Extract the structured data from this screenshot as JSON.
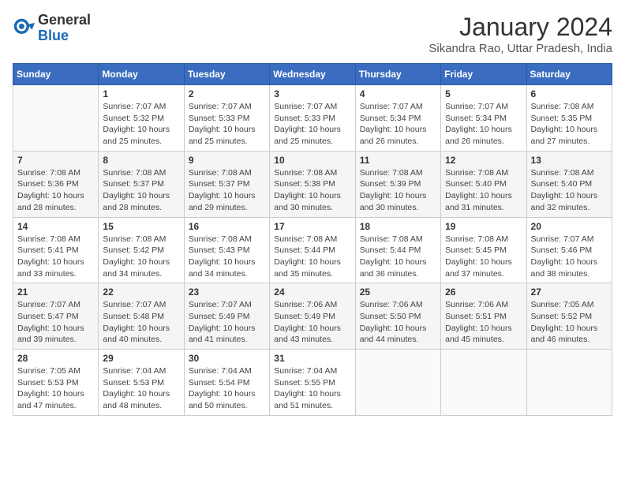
{
  "header": {
    "logo_general": "General",
    "logo_blue": "Blue",
    "month_year": "January 2024",
    "location": "Sikandra Rao, Uttar Pradesh, India"
  },
  "weekdays": [
    "Sunday",
    "Monday",
    "Tuesday",
    "Wednesday",
    "Thursday",
    "Friday",
    "Saturday"
  ],
  "weeks": [
    [
      {
        "day": "",
        "info": ""
      },
      {
        "day": "1",
        "info": "Sunrise: 7:07 AM\nSunset: 5:32 PM\nDaylight: 10 hours\nand 25 minutes."
      },
      {
        "day": "2",
        "info": "Sunrise: 7:07 AM\nSunset: 5:33 PM\nDaylight: 10 hours\nand 25 minutes."
      },
      {
        "day": "3",
        "info": "Sunrise: 7:07 AM\nSunset: 5:33 PM\nDaylight: 10 hours\nand 25 minutes."
      },
      {
        "day": "4",
        "info": "Sunrise: 7:07 AM\nSunset: 5:34 PM\nDaylight: 10 hours\nand 26 minutes."
      },
      {
        "day": "5",
        "info": "Sunrise: 7:07 AM\nSunset: 5:34 PM\nDaylight: 10 hours\nand 26 minutes."
      },
      {
        "day": "6",
        "info": "Sunrise: 7:08 AM\nSunset: 5:35 PM\nDaylight: 10 hours\nand 27 minutes."
      }
    ],
    [
      {
        "day": "7",
        "info": "Sunrise: 7:08 AM\nSunset: 5:36 PM\nDaylight: 10 hours\nand 28 minutes."
      },
      {
        "day": "8",
        "info": "Sunrise: 7:08 AM\nSunset: 5:37 PM\nDaylight: 10 hours\nand 28 minutes."
      },
      {
        "day": "9",
        "info": "Sunrise: 7:08 AM\nSunset: 5:37 PM\nDaylight: 10 hours\nand 29 minutes."
      },
      {
        "day": "10",
        "info": "Sunrise: 7:08 AM\nSunset: 5:38 PM\nDaylight: 10 hours\nand 30 minutes."
      },
      {
        "day": "11",
        "info": "Sunrise: 7:08 AM\nSunset: 5:39 PM\nDaylight: 10 hours\nand 30 minutes."
      },
      {
        "day": "12",
        "info": "Sunrise: 7:08 AM\nSunset: 5:40 PM\nDaylight: 10 hours\nand 31 minutes."
      },
      {
        "day": "13",
        "info": "Sunrise: 7:08 AM\nSunset: 5:40 PM\nDaylight: 10 hours\nand 32 minutes."
      }
    ],
    [
      {
        "day": "14",
        "info": "Sunrise: 7:08 AM\nSunset: 5:41 PM\nDaylight: 10 hours\nand 33 minutes."
      },
      {
        "day": "15",
        "info": "Sunrise: 7:08 AM\nSunset: 5:42 PM\nDaylight: 10 hours\nand 34 minutes."
      },
      {
        "day": "16",
        "info": "Sunrise: 7:08 AM\nSunset: 5:43 PM\nDaylight: 10 hours\nand 34 minutes."
      },
      {
        "day": "17",
        "info": "Sunrise: 7:08 AM\nSunset: 5:44 PM\nDaylight: 10 hours\nand 35 minutes."
      },
      {
        "day": "18",
        "info": "Sunrise: 7:08 AM\nSunset: 5:44 PM\nDaylight: 10 hours\nand 36 minutes."
      },
      {
        "day": "19",
        "info": "Sunrise: 7:08 AM\nSunset: 5:45 PM\nDaylight: 10 hours\nand 37 minutes."
      },
      {
        "day": "20",
        "info": "Sunrise: 7:07 AM\nSunset: 5:46 PM\nDaylight: 10 hours\nand 38 minutes."
      }
    ],
    [
      {
        "day": "21",
        "info": "Sunrise: 7:07 AM\nSunset: 5:47 PM\nDaylight: 10 hours\nand 39 minutes."
      },
      {
        "day": "22",
        "info": "Sunrise: 7:07 AM\nSunset: 5:48 PM\nDaylight: 10 hours\nand 40 minutes."
      },
      {
        "day": "23",
        "info": "Sunrise: 7:07 AM\nSunset: 5:49 PM\nDaylight: 10 hours\nand 41 minutes."
      },
      {
        "day": "24",
        "info": "Sunrise: 7:06 AM\nSunset: 5:49 PM\nDaylight: 10 hours\nand 43 minutes."
      },
      {
        "day": "25",
        "info": "Sunrise: 7:06 AM\nSunset: 5:50 PM\nDaylight: 10 hours\nand 44 minutes."
      },
      {
        "day": "26",
        "info": "Sunrise: 7:06 AM\nSunset: 5:51 PM\nDaylight: 10 hours\nand 45 minutes."
      },
      {
        "day": "27",
        "info": "Sunrise: 7:05 AM\nSunset: 5:52 PM\nDaylight: 10 hours\nand 46 minutes."
      }
    ],
    [
      {
        "day": "28",
        "info": "Sunrise: 7:05 AM\nSunset: 5:53 PM\nDaylight: 10 hours\nand 47 minutes."
      },
      {
        "day": "29",
        "info": "Sunrise: 7:04 AM\nSunset: 5:53 PM\nDaylight: 10 hours\nand 48 minutes."
      },
      {
        "day": "30",
        "info": "Sunrise: 7:04 AM\nSunset: 5:54 PM\nDaylight: 10 hours\nand 50 minutes."
      },
      {
        "day": "31",
        "info": "Sunrise: 7:04 AM\nSunset: 5:55 PM\nDaylight: 10 hours\nand 51 minutes."
      },
      {
        "day": "",
        "info": ""
      },
      {
        "day": "",
        "info": ""
      },
      {
        "day": "",
        "info": ""
      }
    ]
  ]
}
